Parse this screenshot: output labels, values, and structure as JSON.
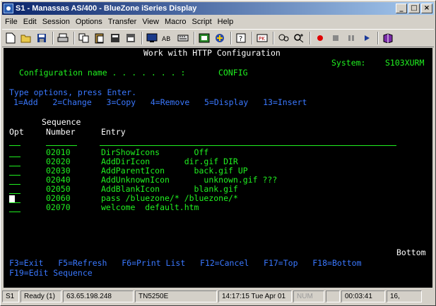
{
  "window": {
    "title": "S1 - Manassas AS/400 - BlueZone iSeries Display",
    "controls": [
      "minimize",
      "maximize",
      "close"
    ]
  },
  "menu": [
    "File",
    "Edit",
    "Session",
    "Options",
    "Transfer",
    "View",
    "Macro",
    "Script",
    "Help"
  ],
  "toolbar_icons": [
    "new-session-icon",
    "open-icon",
    "save-icon",
    "print-screen-icon",
    "copy-icon",
    "paste-icon",
    "copy-append-icon",
    "paste-special-icon",
    "display-icon",
    "hotspot-icon",
    "keyboard-icon",
    "properties-icon",
    "session-manager-icon",
    "help-icon",
    "kiosk-icon",
    "find-icon",
    "zoom-icon",
    "record-icon",
    "stop-icon",
    "pause-icon",
    "play-icon",
    "book-icon"
  ],
  "screen": {
    "heading": "Work with HTTP Configuration",
    "system_label": "System:",
    "system_value": "S103XURM",
    "config_label": "Configuration name . . . . . . . :",
    "config_value": "CONFIG",
    "instructions": "Type options, press Enter.",
    "options": "1=Add   2=Change   3=Copy   4=Remove   5=Display   13=Insert",
    "col_headers": {
      "opt": "Opt",
      "seq_top": "Sequence",
      "seq_bottom": "Number",
      "entry": "Entry"
    },
    "rows": [
      {
        "number": "02010",
        "entry": "DirShowIcons       Off"
      },
      {
        "number": "02020",
        "entry": "AddDirIcon       dir.gif DIR"
      },
      {
        "number": "02030",
        "entry": "AddParentIcon      back.gif UP"
      },
      {
        "number": "02040",
        "entry": "AddUnknownIcon       unknown.gif ???"
      },
      {
        "number": "02050",
        "entry": "AddBlankIcon       blank.gif"
      },
      {
        "number": "02060",
        "entry": "pass /bluezone/* /bluezone/*"
      },
      {
        "number": "02070",
        "entry": "welcome  default.htm"
      }
    ],
    "bottom_indicator": "Bottom",
    "fkeys_line1": "F3=Exit   F5=Refresh   F6=Print List   F12=Cancel   F17=Top   F18=Bottom",
    "fkeys_line2": "F19=Edit Sequence"
  },
  "status": {
    "session": "S1",
    "ready": "Ready (1)",
    "host": "63.65.198.248",
    "terminal_type": "TN5250E",
    "clock": "14:17:15  Tue Apr 01",
    "num": "NUM",
    "elapsed": "00:03:41",
    "position": "16,"
  },
  "colors": {
    "screen_bg": "#000000",
    "field_text": "#20f020",
    "heading_text": "#ffffff",
    "instruction_text": "#3a78ff",
    "titlebar_start": "#0a246a",
    "titlebar_end": "#a6caf0"
  }
}
